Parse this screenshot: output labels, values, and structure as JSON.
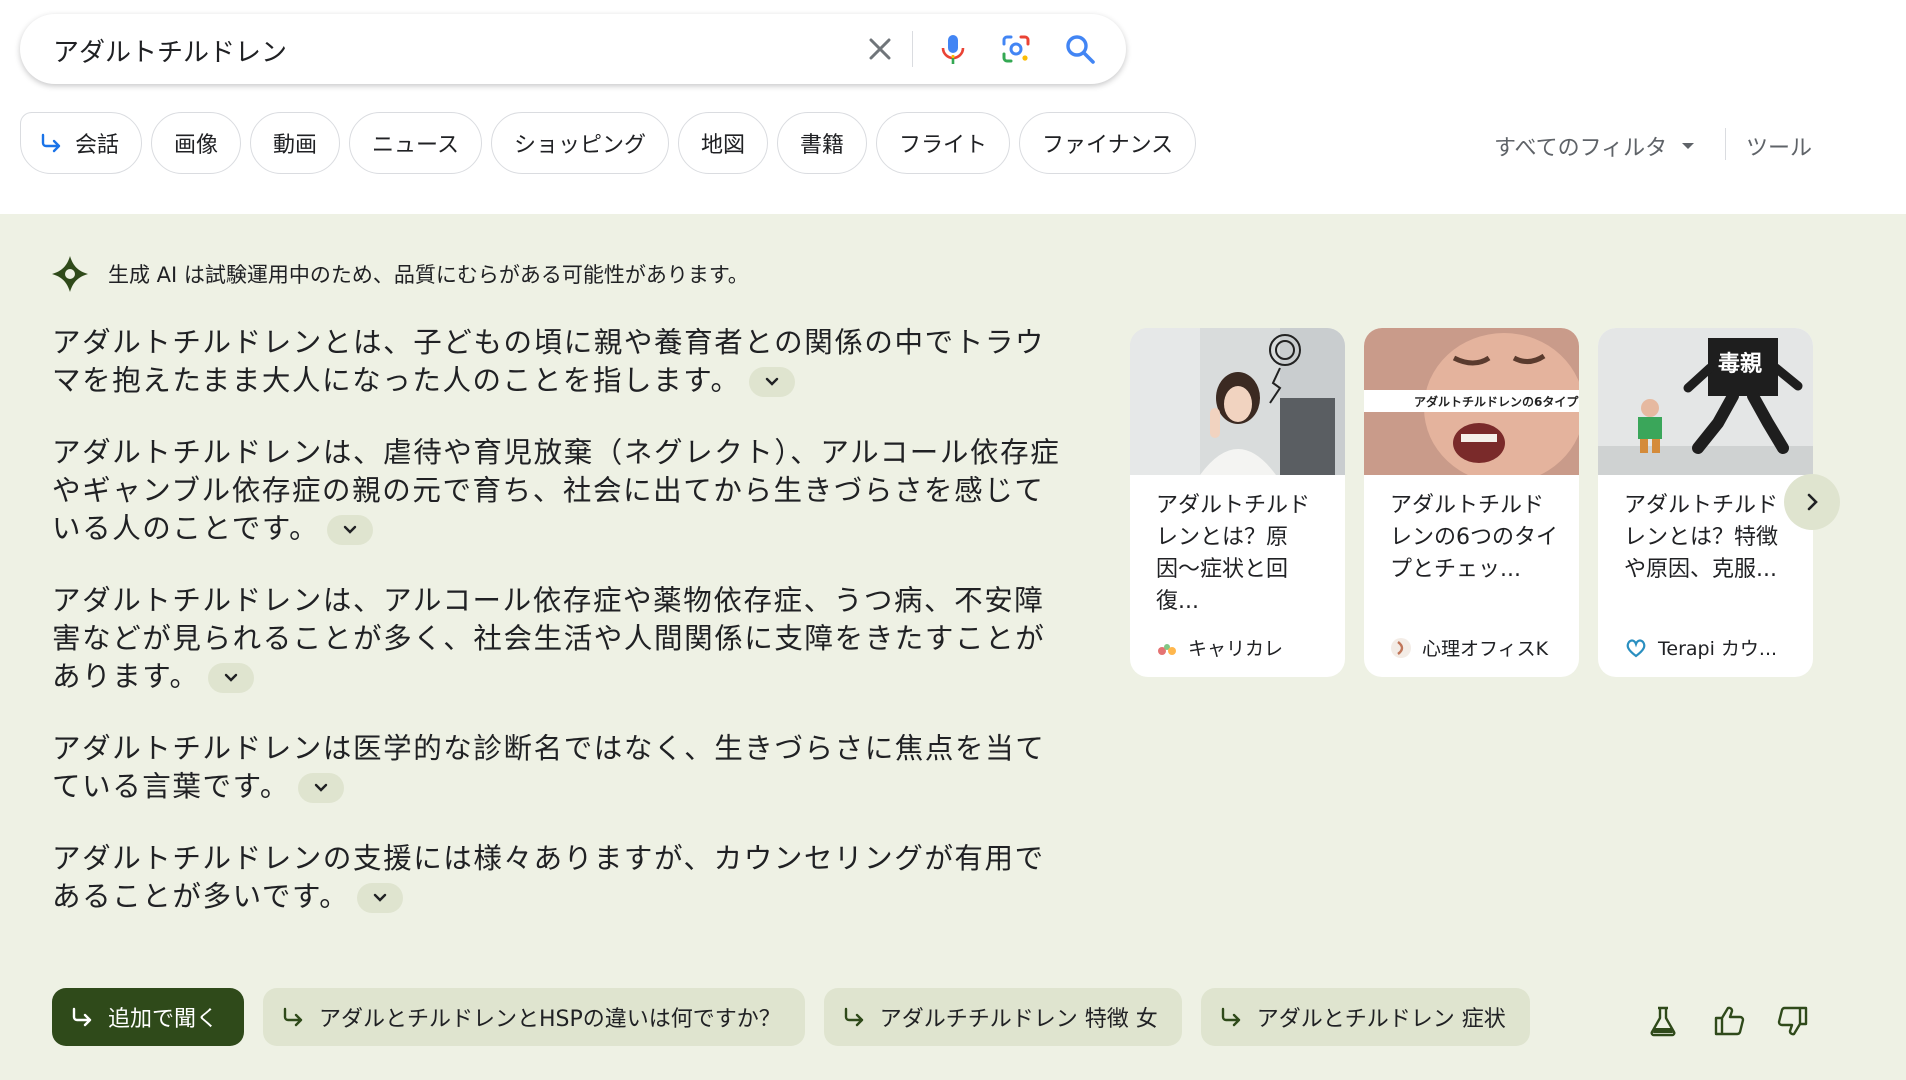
{
  "search": {
    "query": "アダルトチルドレン"
  },
  "icons": {
    "clear": "close-icon",
    "voice": "mic-icon",
    "lens": "camera-lens-icon",
    "search": "search-icon"
  },
  "filters": {
    "chips": [
      "会話",
      "画像",
      "動画",
      "ニュース",
      "ショッピング",
      "地図",
      "書籍",
      "フライト",
      "ファイナンス"
    ],
    "all_filters": "すべてのフィルタ",
    "tools": "ツール"
  },
  "ai_overview": {
    "disclaimer": "生成 AI は試験運用中のため、品質にむらがある可能性があります。",
    "paragraphs": [
      "アダルトチルドレンとは、子どもの頃に親や養育者との関係の中でトラウマを抱えたまま大人になった人のことを指します。",
      "アダルトチルドレンは、虐待や育児放棄（ネグレクト）、アルコール依存症やギャンブル依存症の親の元で育ち、社会に出てから生きづらさを感じている人のことです。",
      "アダルトチルドレンは、アルコール依存症や薬物依存症、うつ病、不安障害などが見られることが多く、社会生活や人間関係に支障をきたすことがあります。",
      "アダルトチルドレンは医学的な診断名ではなく、生きづらさに焦点を当てている言葉です。",
      "アダルトチルドレンの支援には様々ありますが、カウンセリングが有用であることが多いです。"
    ],
    "cards": [
      {
        "title": "アダルトチルドレンとは？原因〜症状と回復...",
        "source": "キャリカレ"
      },
      {
        "title": "アダルトチルドレンの6つのタイプとチェッ...",
        "source": "心理オフィスK",
        "thumb_caption": "アダルトチルドレンの6タイプ"
      },
      {
        "title": "アダルトチルドレンとは？特徴や原因、克服...",
        "source": "Terapi カウ...",
        "thumb_caption": "毒親"
      }
    ],
    "followups": {
      "primary": "追加で聞く",
      "items": [
        "アダルとチルドレンとHSPの違いは何ですか？",
        "アダルチチルドレン 特徴 女",
        "アダルとチルドレン 症状"
      ]
    }
  },
  "colors": {
    "panel_bg": "#eef1e4",
    "chip_bg": "#dfe4cf",
    "primary_btn": "#2f4a1a",
    "accent_blue": "#4285f4"
  }
}
